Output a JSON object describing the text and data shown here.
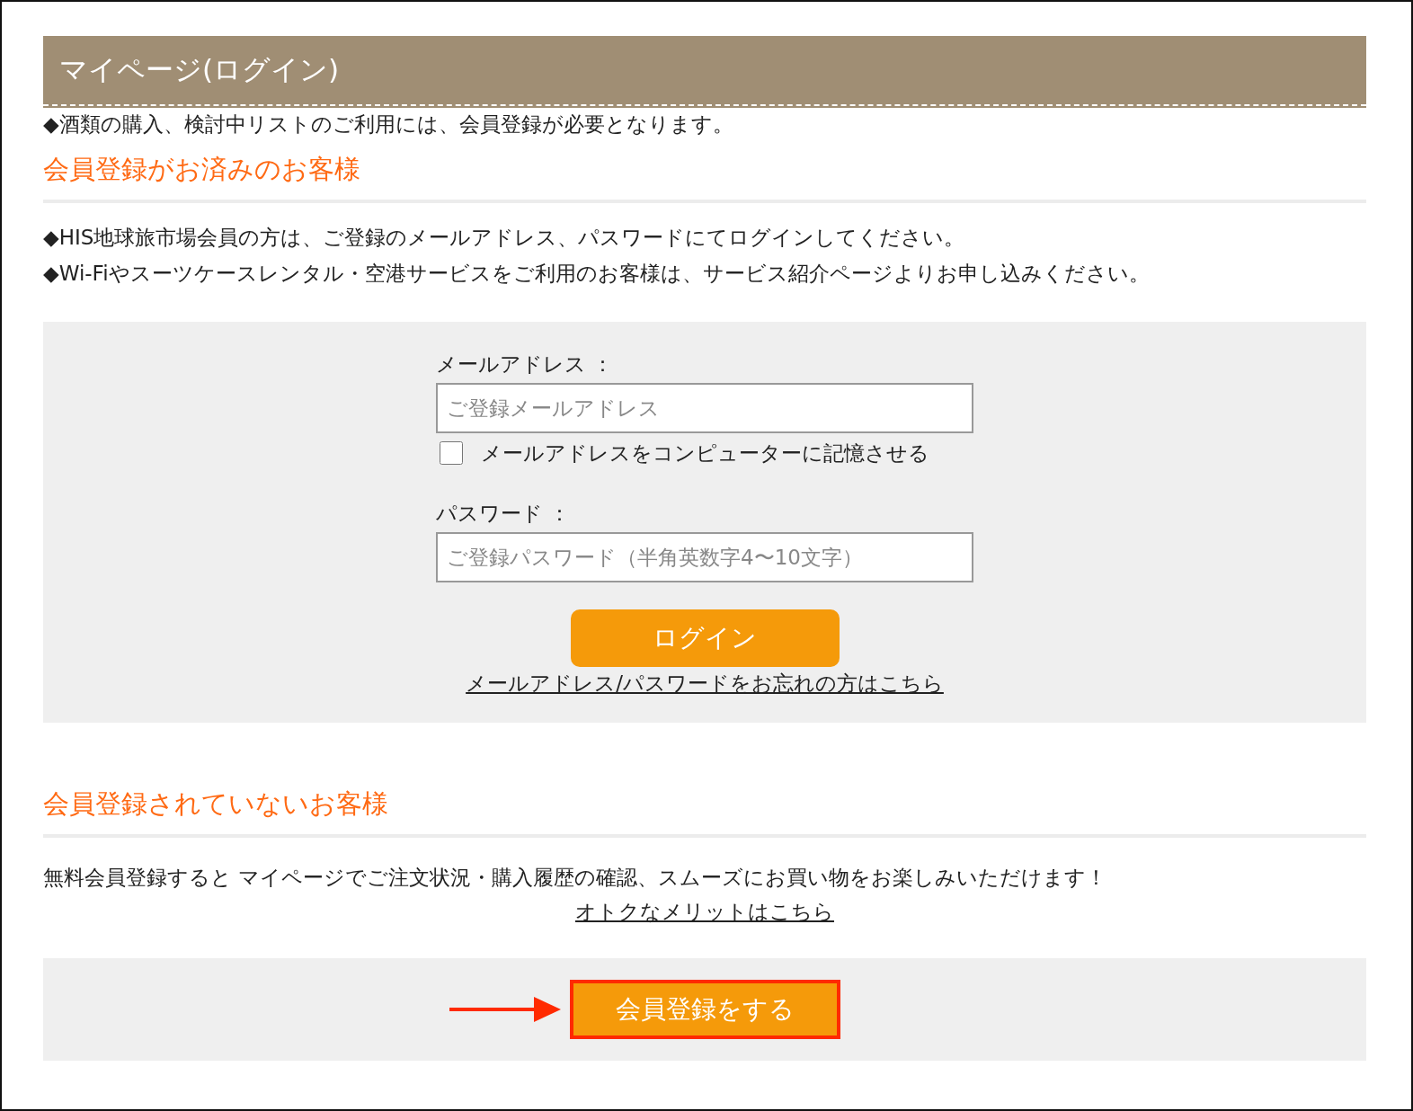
{
  "header": {
    "title": "マイページ(ログイン)"
  },
  "notice": "◆酒類の購入、検討中リストのご利用には、会員登録が必要となります。",
  "member_section": {
    "heading": "会員登録がお済みのお客様",
    "notes": [
      "◆HIS地球旅市場会員の方は、ご登録のメールアドレス、パスワードにてログインしてください。",
      "◆Wi-Fiやスーツケースレンタル・空港サービスをご利用のお客様は、サービス紹介ページよりお申し込みください。"
    ],
    "email": {
      "label": "メールアドレス ：",
      "placeholder": "ご登録メールアドレス"
    },
    "remember": {
      "label": "メールアドレスをコンピューターに記憶させる",
      "checked": false
    },
    "password": {
      "label": "パスワード ：",
      "placeholder": "ご登録パスワード（半角英数字4〜10文字）"
    },
    "login_button": "ログイン",
    "forgot_link": "メールアドレス/パスワードをお忘れの方はこちら"
  },
  "guest_section": {
    "heading": "会員登録されていないお客様",
    "description": "無料会員登録すると マイページでご注文状況・購入履歴の確認、スムーズにお買い物をお楽しみいただけます！",
    "merit_link": "オトクなメリットはこちら",
    "register_button": {
      "label": "会員登録をする",
      "highlighted": true
    }
  }
}
